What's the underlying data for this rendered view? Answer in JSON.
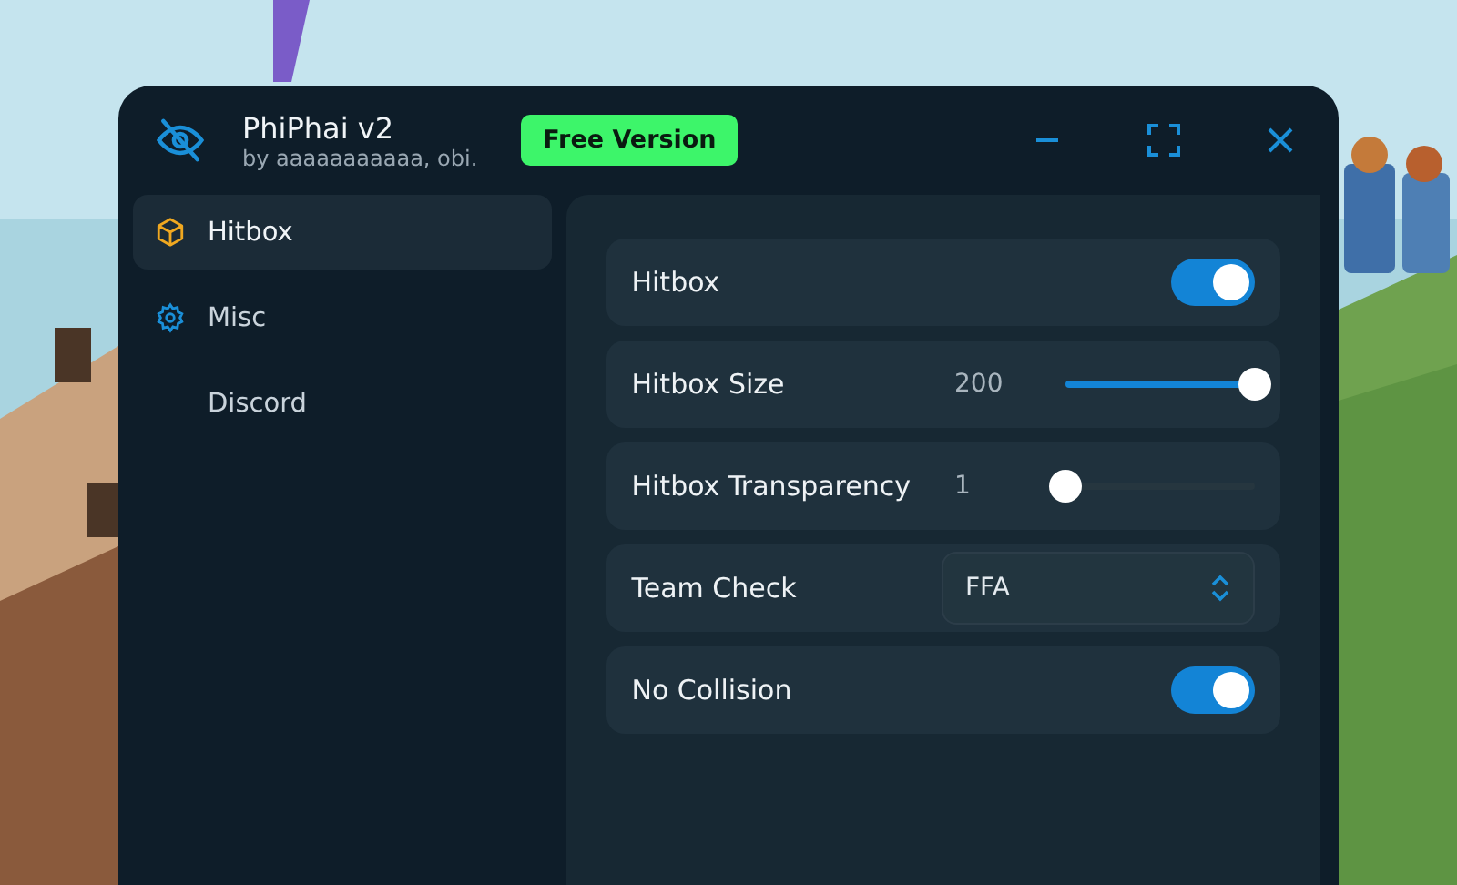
{
  "window": {
    "title": "PhiPhai v2",
    "subtitle": "by aaaaaaaaaaa, obi.",
    "badge": "Free Version"
  },
  "sidebar": {
    "items": [
      {
        "label": "Hitbox",
        "selected": true
      },
      {
        "label": "Misc",
        "selected": false
      },
      {
        "label": "Discord",
        "selected": false
      }
    ]
  },
  "settings": [
    {
      "kind": "toggle",
      "label": "Hitbox",
      "on": true
    },
    {
      "kind": "slider",
      "label": "Hitbox Size",
      "reading": "200",
      "level": 1
    },
    {
      "kind": "slider",
      "label": "Hitbox Transparency",
      "reading": "1",
      "level": 0
    },
    {
      "kind": "dropdown",
      "label": "Team Check",
      "value": "FFA"
    },
    {
      "kind": "toggle",
      "label": "No Collision",
      "on": true
    }
  ]
}
